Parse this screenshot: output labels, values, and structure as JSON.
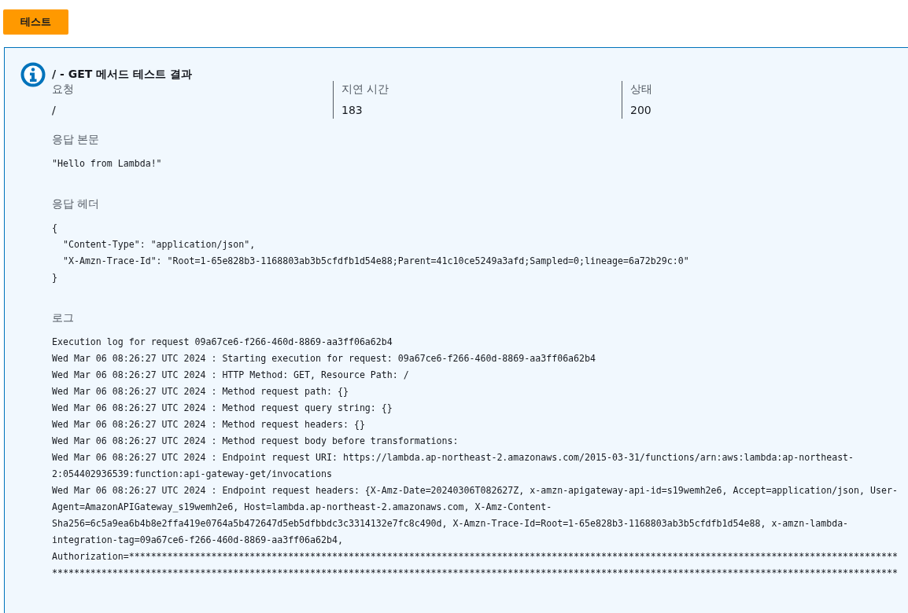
{
  "test_button": {
    "label": "테스트"
  },
  "result": {
    "title": "/ - GET 메서드 테스트 결과",
    "summary": [
      {
        "label": "요청",
        "value": "/"
      },
      {
        "label": "지연 시간",
        "value": "183"
      },
      {
        "label": "상태",
        "value": "200"
      }
    ],
    "response_body": {
      "label": "응답 본문",
      "lines": [
        "\"Hello from Lambda!\""
      ]
    },
    "response_headers": {
      "label": "응답 헤더",
      "lines": [
        "{",
        "  \"Content-Type\": \"application/json\",",
        "  \"X-Amzn-Trace-Id\": \"Root=1-65e828b3-1168803ab3b5cfdfb1d54e88;Parent=41c10ce5249a3afd;Sampled=0;lineage=6a72b29c:0\"",
        "}"
      ]
    },
    "logs": {
      "label": "로그",
      "lines": [
        "Execution log for request 09a67ce6-f266-460d-8869-aa3ff06a62b4",
        "Wed Mar 06 08:26:27 UTC 2024 : Starting execution for request: 09a67ce6-f266-460d-8869-aa3ff06a62b4",
        "Wed Mar 06 08:26:27 UTC 2024 : HTTP Method: GET, Resource Path: /",
        "Wed Mar 06 08:26:27 UTC 2024 : Method request path: {}",
        "Wed Mar 06 08:26:27 UTC 2024 : Method request query string: {}",
        "Wed Mar 06 08:26:27 UTC 2024 : Method request headers: {}",
        "Wed Mar 06 08:26:27 UTC 2024 : Method request body before transformations:",
        "Wed Mar 06 08:26:27 UTC 2024 : Endpoint request URI: https://lambda.ap-northeast-2.amazonaws.com/2015-03-31/functions/arn:aws:lambda:ap-northeast-",
        "2:054402936539:function:api-gateway-get/invocations",
        "Wed Mar 06 08:26:27 UTC 2024 : Endpoint request headers: {X-Amz-Date=20240306T082627Z, x-amzn-apigateway-api-id=s19wemh2e6, Accept=application/json, User-",
        "Agent=AmazonAPIGateway_s19wemh2e6, Host=lambda.ap-northeast-2.amazonaws.com, X-Amz-Content-",
        "Sha256=6c5a9ea6b4b8e2ffa419e0764a5b472647d5eb5dfbbdc3c3314132e7fc8c490d, X-Amzn-Trace-Id=Root=1-65e828b3-1168803ab3b5cfdfb1d54e88, x-amzn-lambda-",
        "integration-tag=09a67ce6-f266-460d-8869-aa3ff06a62b4,",
        "Authorization=********************************************************************************************************************************************",
        "**********************************************************************************************************************************************************"
      ]
    }
  }
}
